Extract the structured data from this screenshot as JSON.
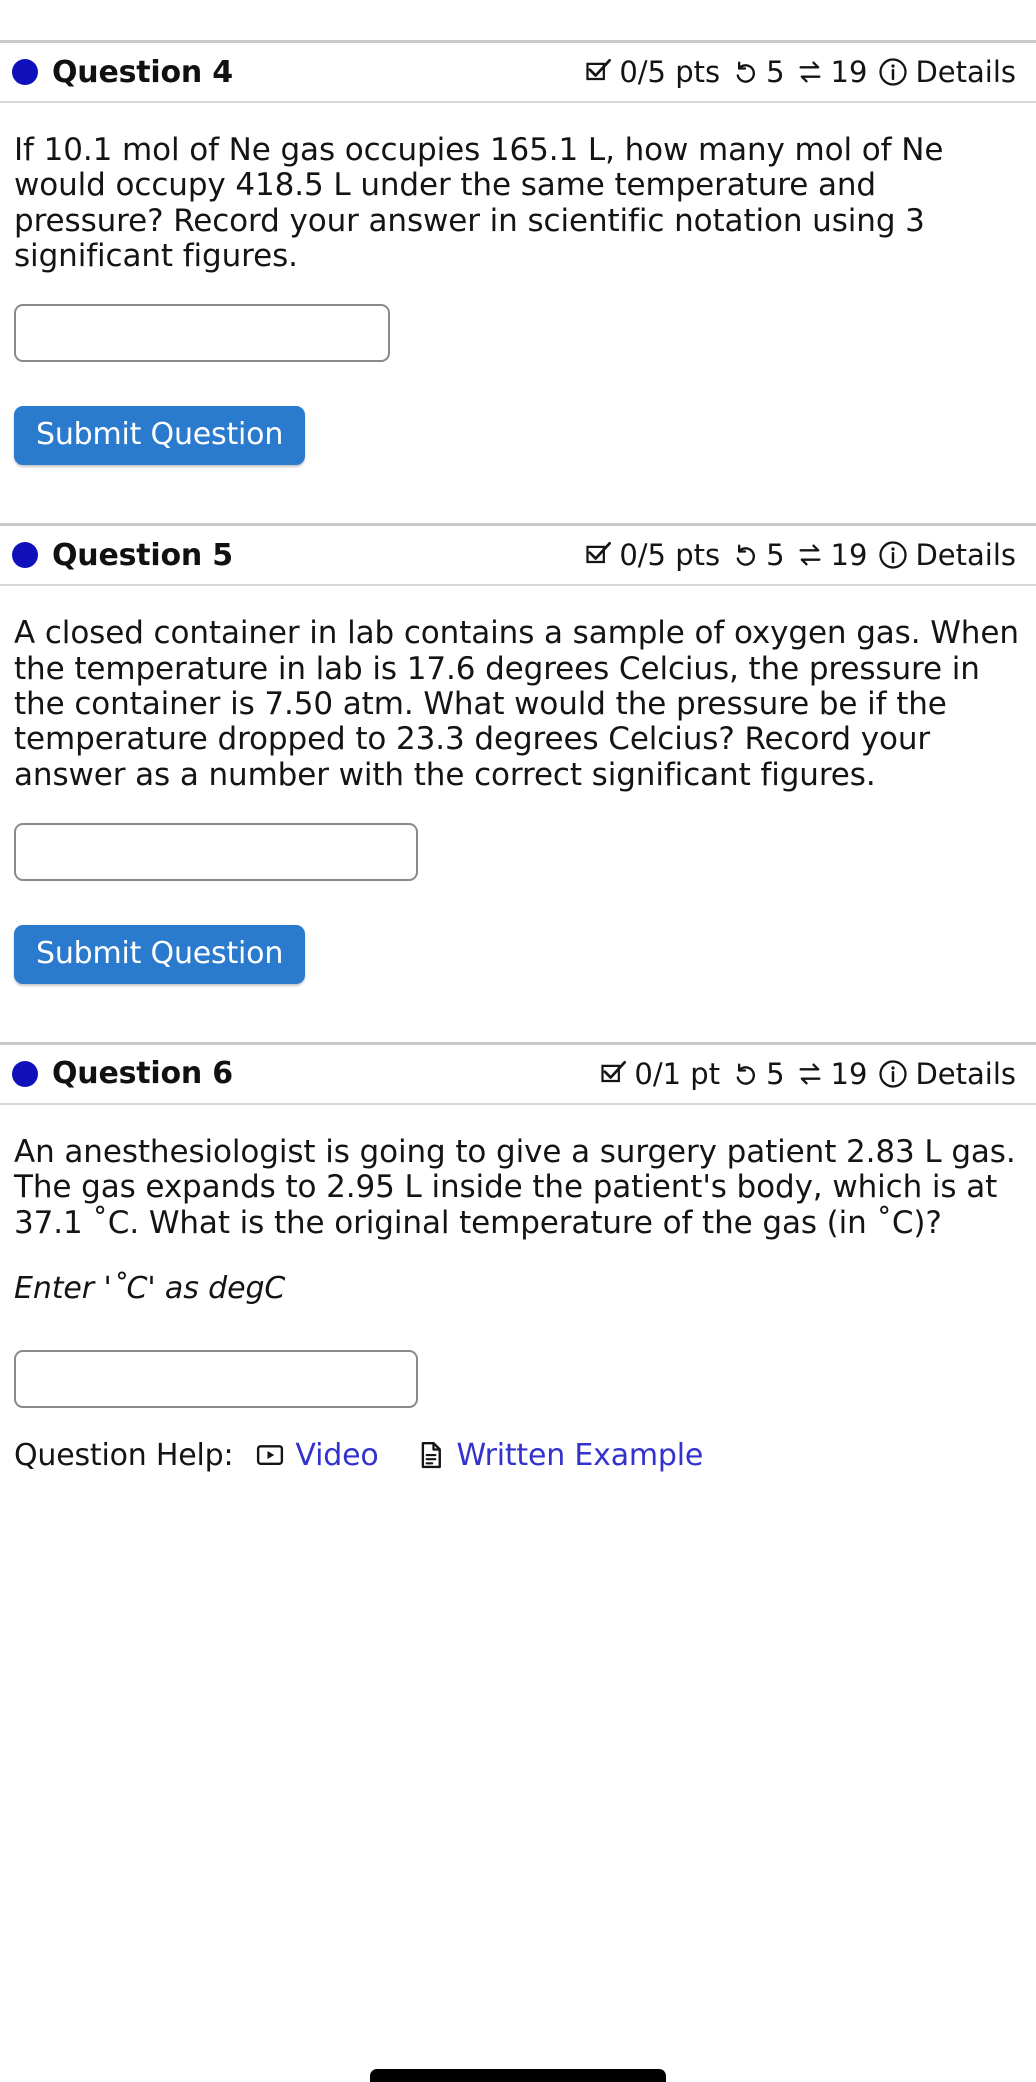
{
  "questions": [
    {
      "number_label": "Question 4",
      "points": "0/5 pts",
      "attempts": "5",
      "retries": "19",
      "details_label": "Details",
      "prompt": "If 10.1 mol of Ne gas occupies 165.1 L, how many mol of Ne would occupy 418.5 L under the same temperature and pressure? Record your answer in scientific notation using 3 significant figures.",
      "answer_value": "",
      "answer_placeholder": "",
      "submit_label": "Submit Question"
    },
    {
      "number_label": "Question 5",
      "points": "0/5 pts",
      "attempts": "5",
      "retries": "19",
      "details_label": "Details",
      "prompt": "A closed container in lab contains a sample of oxygen gas. When the temperature in lab is 17.6 degrees Celcius, the pressure in the container is 7.50 atm. What would the pressure be if the temperature dropped to 23.3 degrees Celcius? Record your answer as a number with the correct significant figures.",
      "answer_value": "",
      "answer_placeholder": "",
      "submit_label": "Submit Question"
    },
    {
      "number_label": "Question 6",
      "points": "0/1 pt",
      "attempts": "5",
      "retries": "19",
      "details_label": "Details",
      "prompt": "An anesthesiologist is going to give a surgery patient 2.83 L gas. The gas expands to 2.95 L inside the patient's body, which is at 37.1 ˚C. What is the original temperature of the gas (in ˚C)?",
      "note": "Enter '˚C' as degC",
      "answer_value": "",
      "answer_placeholder": "",
      "help_label": "Question Help:",
      "help_video_label": "Video",
      "help_written_label": "Written Example"
    }
  ],
  "icons": {
    "status_dot": "filled-circle-icon",
    "points": "checkbox-checked-icon",
    "attempts": "undo-arrow-icon",
    "retries": "two-way-arrows-icon",
    "details": "info-circle-icon",
    "video": "video-play-icon",
    "written": "document-lines-icon"
  },
  "colors": {
    "status_dot": "#1111bb",
    "submit_button": "#2a7ace",
    "link": "#3333cc",
    "rule": "#c9c9c9",
    "input_border": "#8a8a8a"
  }
}
